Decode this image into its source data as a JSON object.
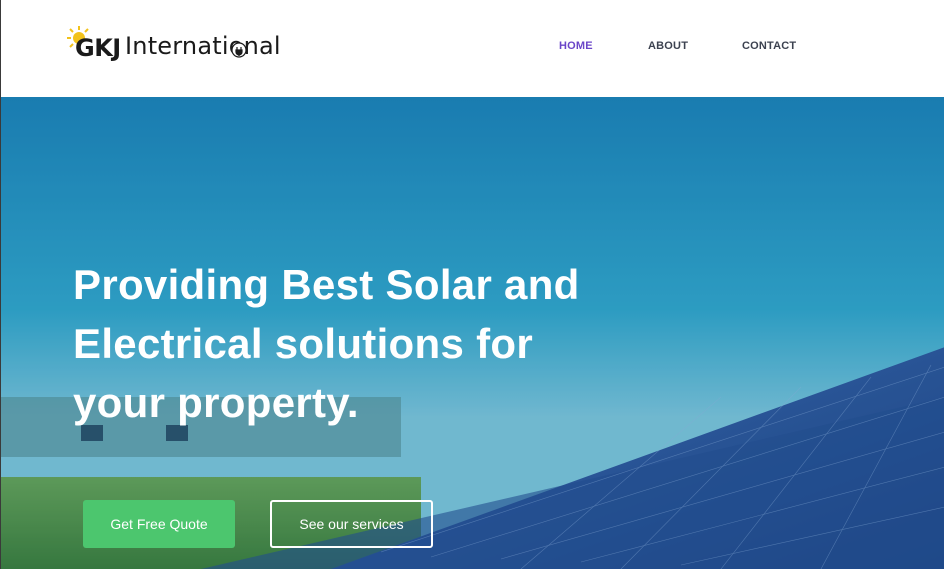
{
  "header": {
    "logo": {
      "brand_bold": "GKJ",
      "brand_rest": "International",
      "sun_icon": "sun-icon",
      "plug_icon": "plug-icon"
    },
    "nav": [
      {
        "label": "HOME",
        "active": true
      },
      {
        "label": "ABOUT",
        "active": false
      },
      {
        "label": "CONTACT",
        "active": false
      }
    ]
  },
  "hero": {
    "title_lines": [
      "Providing Best Solar and",
      "Electrical solutions for",
      "your property."
    ],
    "buttons": {
      "quote_label": "Get Free Quote",
      "services_label": "See our services"
    }
  },
  "colors": {
    "nav_active": "#6a45c8",
    "nav_text": "#3c4250",
    "quote_button": "#4cc66e",
    "sky": "#2aa0c6",
    "panel": "#2b4f8f"
  }
}
